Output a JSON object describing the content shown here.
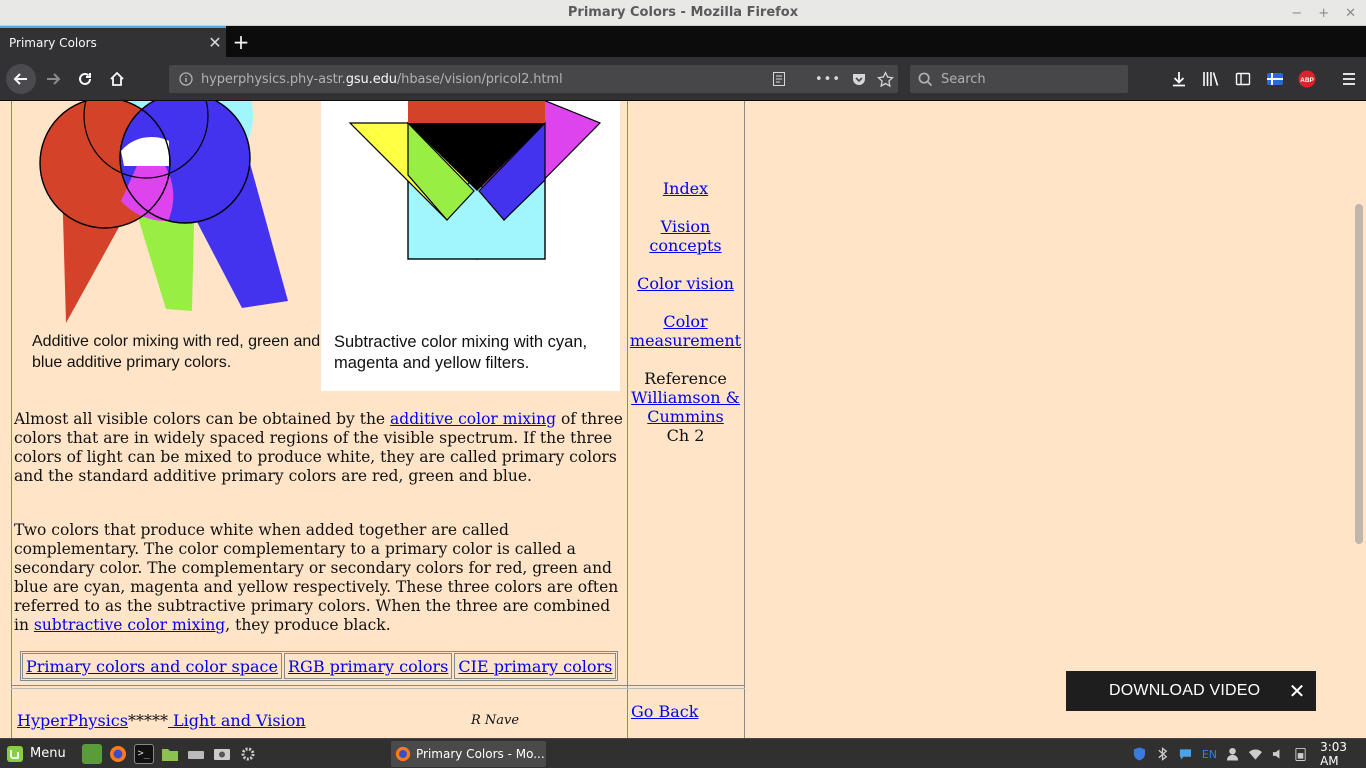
{
  "window": {
    "title": "Primary Colors - Mozilla Firefox",
    "controls": {
      "minimize": "−",
      "maximize": "+",
      "close": "✕"
    }
  },
  "tabs": [
    {
      "label": "Primary Colors",
      "close": "✕"
    }
  ],
  "new_tab": "+",
  "nav": {
    "url_prefix": "hyperphysics.phy-astr.",
    "url_domain": "gsu.edu",
    "url_path": "/hbase/vision/pricol2.html",
    "search_placeholder": "Search",
    "page_actions": "•••",
    "abp_label": "ABP"
  },
  "figures": {
    "additive_caption": "Additive color mixing with red, green and blue additive primary colors.",
    "subtractive_caption": "Subtractive color mixing with cyan, magenta and yellow filters."
  },
  "paragraphs": {
    "p1_before": "Almost all visible colors can be obtained by the ",
    "p1_link": "additive color mixing",
    "p1_after": " of three colors that are in widely spaced regions of the visible spectrum. If the three colors of light can be mixed to produce white, they are called primary colors and the standard additive primary colors are red, green and blue.",
    "p2_before": "Two colors that produce white when added together are called complementary. The color complementary to a primary color is called a secondary color. The complementary or secondary colors for red, green and blue are cyan, magenta and yellow respectively. These three colors are often referred to as the subtractive primary colors. When the three are combined in ",
    "p2_link": "subtractive color mixing",
    "p2_after": ", they produce black."
  },
  "related_links": [
    "Primary colors and color space",
    "RGB primary colors",
    "CIE primary colors"
  ],
  "sidebar": {
    "index": "Index",
    "vision_concepts": "Vision concepts",
    "color_vision": "Color vision",
    "color_measurement": "Color measurement",
    "reference_label": "Reference",
    "reference_link": "Williamson & Cummins",
    "reference_chapter": "Ch 2"
  },
  "footer": {
    "hyperphysics": "HyperPhysics",
    "stars": "*****",
    "light_vision": " Light and Vision",
    "author": "R Nave",
    "go_back": "Go Back"
  },
  "download_video": {
    "label": "DOWNLOAD VIDEO",
    "close": "✕"
  },
  "taskbar": {
    "menu_label": "Menu",
    "window_label": "Primary Colors - Mo...",
    "keyboard_layout": "EN",
    "clock": "3:03 AM"
  },
  "colors": {
    "page_bg": "#ffe4c8",
    "link": "#0000ee",
    "red": "#d4422a",
    "green": "#99ee44",
    "blue": "#4433ee",
    "yellow": "#ffff44",
    "cyan": "#a0f6fc",
    "magenta": "#dd44ee"
  }
}
